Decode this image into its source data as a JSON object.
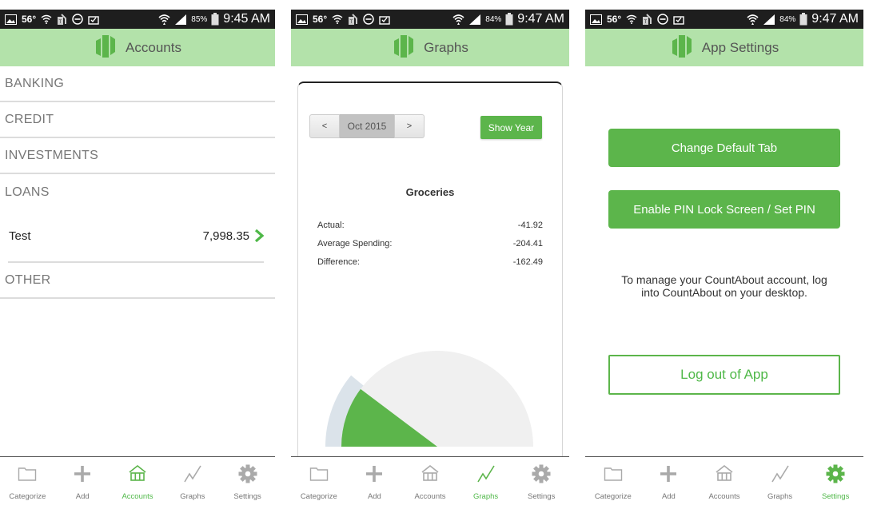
{
  "colors": {
    "accent": "#5cb54b",
    "header_bg": "#b3e2aa",
    "statusbar_bg": "#1e1e1e",
    "gauge_bg": "#f0f0f0",
    "gauge_ring": "#dbe3ea"
  },
  "screens": [
    {
      "status": {
        "temp": "56°",
        "battery": "85%",
        "time": "9:45 AM"
      },
      "title": "Accounts",
      "sections": [
        {
          "label": "BANKING",
          "accounts": []
        },
        {
          "label": "CREDIT",
          "accounts": []
        },
        {
          "label": "INVESTMENTS",
          "accounts": []
        },
        {
          "label": "LOANS",
          "accounts": [
            {
              "name": "Test",
              "amount": "7,998.35"
            }
          ]
        },
        {
          "label": "OTHER",
          "accounts": []
        }
      ],
      "active_tab": "Accounts"
    },
    {
      "status": {
        "temp": "56°",
        "battery": "84%",
        "time": "9:47 AM"
      },
      "title": "Graphs",
      "nav": {
        "prev": "<",
        "month": "Oct 2015",
        "next": ">",
        "show_year": "Show Year"
      },
      "category": "Groceries",
      "stats": [
        {
          "label": "Actual:",
          "value": "-41.92"
        },
        {
          "label": "Average Spending:",
          "value": "-204.41"
        },
        {
          "label": "Difference:",
          "value": "-162.49"
        }
      ],
      "active_tab": "Graphs"
    },
    {
      "status": {
        "temp": "56°",
        "battery": "84%",
        "time": "9:47 AM"
      },
      "title": "App Settings",
      "buttons": {
        "change_tab": "Change Default Tab",
        "pin": "Enable PIN Lock Screen / Set PIN",
        "logout": "Log out of App"
      },
      "manage_text": "To manage your CountAbout account, log into CountAbout on your desktop.",
      "active_tab": "Settings"
    }
  ],
  "tabs": [
    {
      "label": "Categorize",
      "icon": "folder-icon"
    },
    {
      "label": "Add",
      "icon": "plus-icon"
    },
    {
      "label": "Accounts",
      "icon": "bank-icon"
    },
    {
      "label": "Graphs",
      "icon": "graph-icon"
    },
    {
      "label": "Settings",
      "icon": "gear-icon"
    }
  ],
  "chart_data": {
    "type": "gauge",
    "title": "Groceries",
    "actual": 41.92,
    "average": 204.41,
    "ring_fraction": 0.22,
    "range": [
      0,
      204.41
    ]
  }
}
